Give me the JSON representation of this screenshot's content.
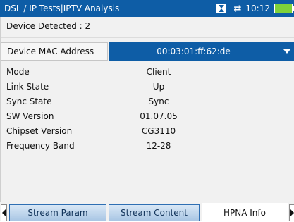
{
  "title_bar": {
    "title": "DSL / IP Tests|IPTV Analysis",
    "clock": "10:12"
  },
  "device_detected": "Device Detected : 2",
  "mac": {
    "label": "Device MAC Address",
    "value": "00:03:01:ff:62:de"
  },
  "details": [
    {
      "label": "Mode",
      "value": "Client"
    },
    {
      "label": "Link State",
      "value": "Up"
    },
    {
      "label": "Sync State",
      "value": "Sync"
    },
    {
      "label": "SW Version",
      "value": "01.07.05"
    },
    {
      "label": "Chipset Version",
      "value": "CG3110"
    },
    {
      "label": "Frequency Band",
      "value": "12-28"
    }
  ],
  "tabs": [
    {
      "label": "Stream Param"
    },
    {
      "label": "Stream Content"
    },
    {
      "label": "HPNA Info"
    }
  ],
  "colors": {
    "title_bar": "#0e5da6",
    "selection": "#0e5da6",
    "battery": "#7fd23a"
  },
  "icons": [
    "hourglass-icon",
    "signal-icon",
    "battery-icon",
    "dropdown-arrow-icon",
    "tab-scroll-left-icon",
    "tab-scroll-right-icon"
  ]
}
